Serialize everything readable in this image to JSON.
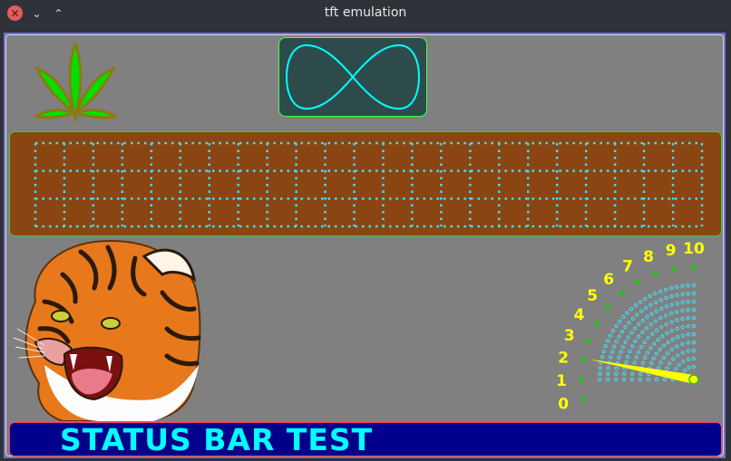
{
  "window": {
    "title": "tft emulation",
    "close_icon": "close-icon",
    "minimize_icon": "chevron-down-icon",
    "maximize_icon": "chevron-up-icon"
  },
  "colors": {
    "screen_bg": "#808080",
    "leaf_green": "#00e000",
    "leaf_outline": "#8b7a14",
    "infinity_bg": "#2d4b4b",
    "infinity_line": "#00ffff",
    "grid_bg": "#8b4513",
    "grid_dots": "#40e0ff",
    "gauge_labels": "#ffff00",
    "gauge_needle": "#ffff00",
    "status_bg": "#00008b",
    "status_text": "#00ffff"
  },
  "gauge": {
    "labels": [
      "0",
      "1",
      "2",
      "3",
      "4",
      "5",
      "6",
      "7",
      "8",
      "9",
      "10"
    ],
    "needle_value": 2.1,
    "max": 10
  },
  "status_bar": {
    "text": "STATUS BAR TEST"
  },
  "grid": {
    "columns": 23,
    "rows": 3
  }
}
